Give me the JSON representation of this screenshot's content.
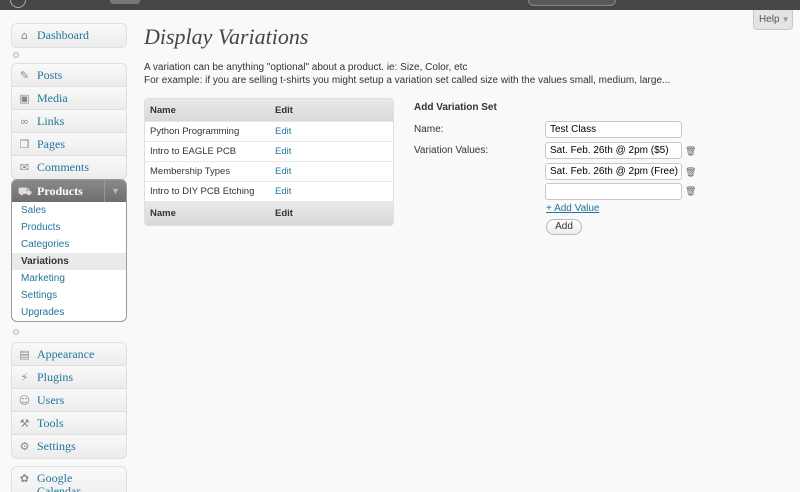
{
  "help": {
    "label": "Help"
  },
  "sidebar": {
    "top": [
      {
        "label": "Dashboard",
        "icon": "house-icon"
      }
    ],
    "content": [
      {
        "label": "Posts",
        "icon": "pushpin-icon"
      },
      {
        "label": "Media",
        "icon": "media-icon"
      },
      {
        "label": "Links",
        "icon": "link-icon"
      },
      {
        "label": "Pages",
        "icon": "pages-icon"
      },
      {
        "label": "Comments",
        "icon": "comment-icon"
      }
    ],
    "products": {
      "label": "Products",
      "items": [
        "Sales",
        "Products",
        "Categories",
        "Variations",
        "Marketing",
        "Settings",
        "Upgrades"
      ],
      "current": "Variations"
    },
    "admin": [
      {
        "label": "Appearance",
        "icon": "appearance-icon"
      },
      {
        "label": "Plugins",
        "icon": "plugin-icon"
      },
      {
        "label": "Users",
        "icon": "users-icon"
      },
      {
        "label": "Tools",
        "icon": "tools-icon"
      },
      {
        "label": "Settings",
        "icon": "settings-icon"
      }
    ],
    "extra": [
      {
        "label": "Google Calendar",
        "icon": "calendar-icon"
      }
    ]
  },
  "main": {
    "title": "Display Variations",
    "desc1": "A variation can be anything \"optional\" about a product. ie: Size, Color, etc",
    "desc2": "For example: if you are selling t-shirts you might setup a variation set called size with the values small, medium, large...",
    "table": {
      "col_name": "Name",
      "col_edit": "Edit",
      "rows": [
        {
          "name": "Python Programming",
          "edit": "Edit"
        },
        {
          "name": "Intro to EAGLE PCB",
          "edit": "Edit"
        },
        {
          "name": "Membership Types",
          "edit": "Edit"
        },
        {
          "name": "Intro to DIY PCB Etching",
          "edit": "Edit"
        }
      ]
    },
    "form": {
      "title": "Add Variation Set",
      "name_label": "Name:",
      "name_value": "Test Class",
      "values_label": "Variation Values:",
      "values": [
        "Sat. Feb. 26th @ 2pm ($5)",
        "Sat. Feb. 26th @ 2pm (Free)",
        ""
      ],
      "add_value": "+ Add Value",
      "add_button": "Add"
    }
  }
}
